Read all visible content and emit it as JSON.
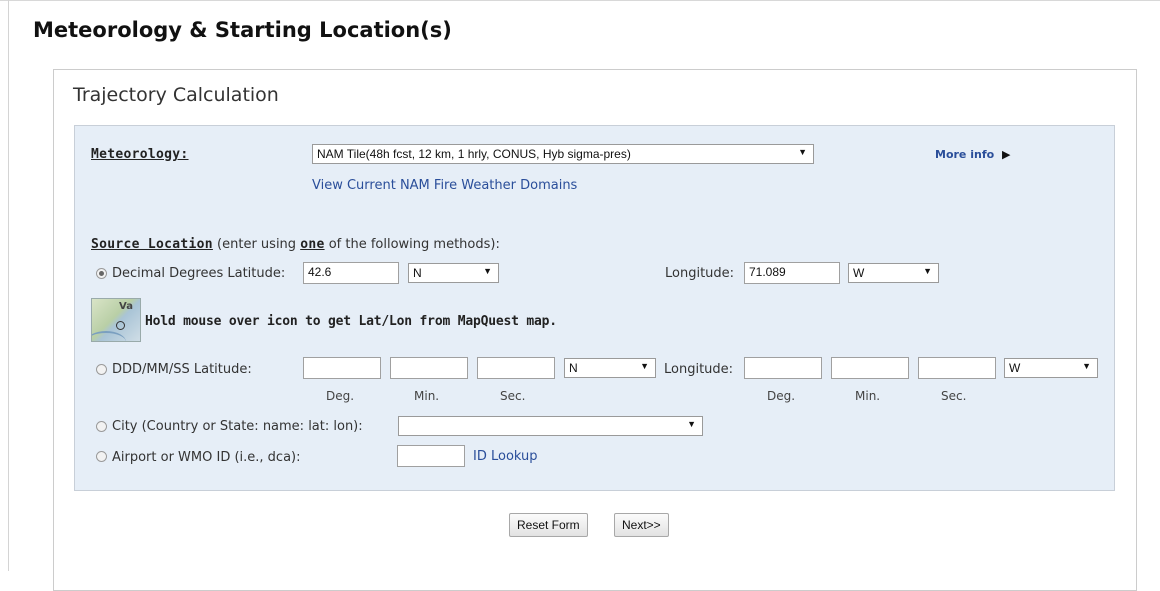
{
  "page": {
    "title": "Meteorology & Starting Location(s)"
  },
  "panel": {
    "heading": "Trajectory Calculation"
  },
  "meteorology": {
    "label": "Meteorology:",
    "selected": "NAM Tile(48h fcst, 12 km, 1 hrly, CONUS, Hyb sigma-pres)",
    "more_info": "More info",
    "domains_link": "View Current NAM Fire Weather Domains"
  },
  "source": {
    "label": "Source Location",
    "intro_a": "(enter using ",
    "intro_one": "one",
    "intro_b": " of the following methods):"
  },
  "decimal": {
    "label": "Decimal Degrees Latitude:",
    "lat_value": "42.6",
    "lat_dir": "N",
    "lon_label": "Longitude:",
    "lon_value": "71.089",
    "lon_dir": "W",
    "selected": true
  },
  "mapquest": {
    "icon_text": "Va",
    "hint": "Hold mouse over icon to get Lat/Lon from MapQuest map."
  },
  "dms": {
    "label": "DDD/MM/SS Latitude:",
    "lat_dir": "N",
    "lon_label": "Longitude:",
    "lon_dir": "W",
    "deg": "Deg.",
    "min": "Min.",
    "sec": "Sec."
  },
  "city": {
    "label": "City (Country or State: name: lat: lon):",
    "selected": ""
  },
  "airport": {
    "label": "Airport or WMO ID (i.e., dca):",
    "value": "",
    "lookup": "ID Lookup"
  },
  "buttons": {
    "reset": "Reset Form",
    "next": "Next>>"
  }
}
